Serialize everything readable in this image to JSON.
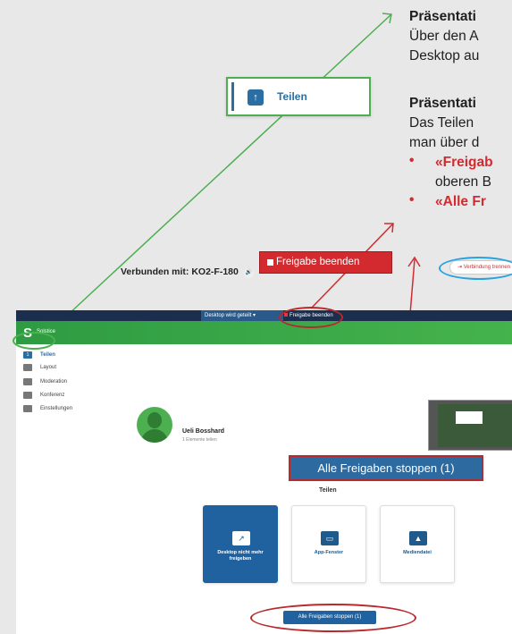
{
  "doc": {
    "heading1": "Präsentati",
    "line1": "Über den A",
    "line2": "Desktop au",
    "heading2": "Präsentati",
    "line3": "Das Teilen",
    "line4": "man über d",
    "bullet1": "«Freigab",
    "bullet1_cont": "oberen B",
    "bullet2": "«Alle Fr",
    "bullet_char": "•"
  },
  "callouts": {
    "teilen_icon": "↑",
    "teilen_label": "Teilen",
    "freigabe_label": "Freigabe beenden",
    "stop_label": "Alle Freigaben stoppen (1)"
  },
  "app": {
    "topbar": {
      "share_status": "Desktop wird geteilt",
      "end_label": "Freigabe beenden"
    },
    "brand_glyph": "S",
    "brand": "Solstice",
    "sidebar": [
      {
        "label": "Teilen",
        "badge": "1",
        "active": true
      },
      {
        "label": "Layout"
      },
      {
        "label": "Moderation"
      },
      {
        "label": "Konferenz"
      },
      {
        "label": "Einstellungen"
      }
    ],
    "connected_title": "Verbunden mit: KO2-F-180",
    "speaker_glyph": "🔊",
    "disconnect_label": "Verbindung trennen",
    "user": {
      "name": "Ueli Bosshard",
      "sub": "1 Elemente teilen"
    },
    "share_heading": "Teilen",
    "cards": [
      {
        "label": "Desktop nicht mehr freigeben",
        "icon": "↗",
        "active": true
      },
      {
        "label": "App-Fenster",
        "icon": "▭"
      },
      {
        "label": "Mediendatei",
        "icon": "▲"
      }
    ],
    "stop_button": "Alle Freigaben stoppen (1)"
  },
  "colors": {
    "accent_blue": "#2062a0",
    "accent_red": "#d32a2f",
    "accent_green": "#4caf50",
    "highlight_blue": "#29a3e0"
  }
}
